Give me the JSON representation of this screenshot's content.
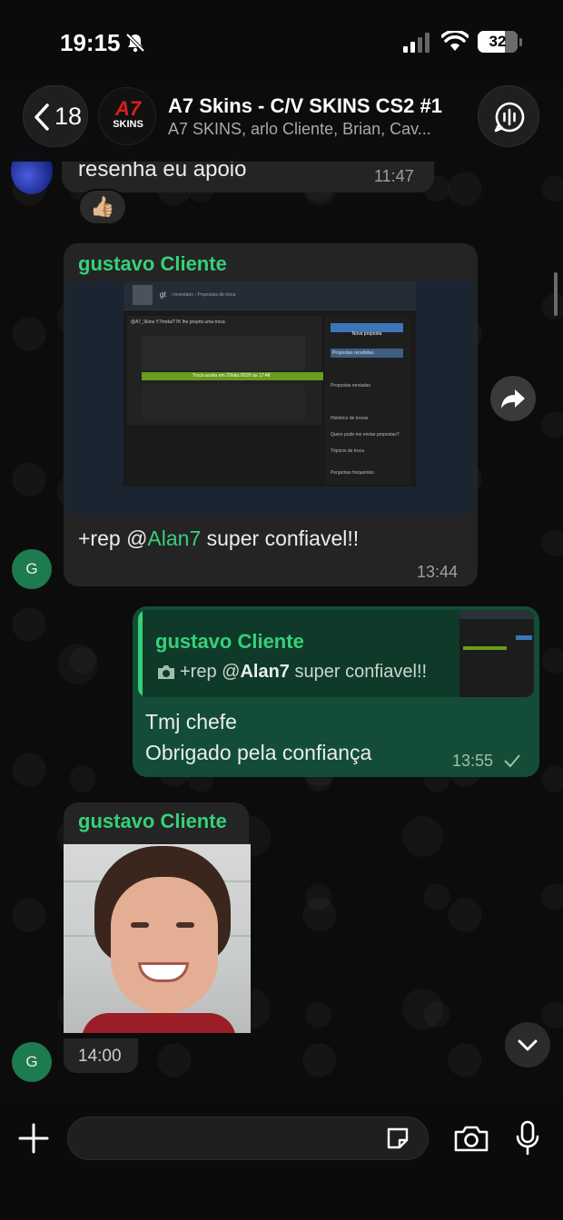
{
  "status_bar": {
    "time": "19:15",
    "battery": "32"
  },
  "header": {
    "back_count": "18",
    "avatar_line1": "A7",
    "avatar_line2": "SKINS",
    "title": "A7 Skins - C/V SKINS CS2 #1",
    "members": "A7 SKINS, arlo Cliente, Brian, Cav..."
  },
  "messages": [
    {
      "type": "text",
      "text": "resenha eu apoio",
      "time": "11:47",
      "reaction": "👍🏼"
    },
    {
      "type": "image",
      "sender": "gustavo Cliente",
      "text_before": "+rep @",
      "mention": "Alan7",
      "text_after": " super confiavel!!",
      "time": "13:44",
      "avatar": "G",
      "screenshot": {
        "user": "gt",
        "crumb": "› Inventário › Propostas de troca",
        "offer_line": "@A7_Skins Y7/mda/T7K lhe propôs uma troca",
        "accepted_line": "Troca aceita em 20/abr./2026 às 17:48",
        "new_offer": "Nova proposta",
        "side_items": [
          "Propostas recebidas",
          "Propostas enviadas",
          "Histórico de trocas",
          "Quem pode me enviar propostas?",
          "Tópicos de troca",
          "Perguntas frequentes"
        ]
      }
    },
    {
      "type": "reply",
      "quoted_sender": "gustavo Cliente",
      "quoted_before": "+rep @",
      "quoted_mention": "Alan7",
      "quoted_after": " super confiavel!!",
      "line1": "Tmj chefe",
      "line2": "Obrigado pela confiança",
      "time": "13:55"
    },
    {
      "type": "photo",
      "sender": "gustavo Cliente",
      "time": "14:00",
      "avatar": "G"
    }
  ],
  "icons": {
    "forward": "forward-arrow-icon",
    "scroll_down": "chevron-down-icon",
    "attach": "plus-icon",
    "sticker": "sticker-icon",
    "camera": "camera-icon",
    "mic": "microphone-icon"
  }
}
